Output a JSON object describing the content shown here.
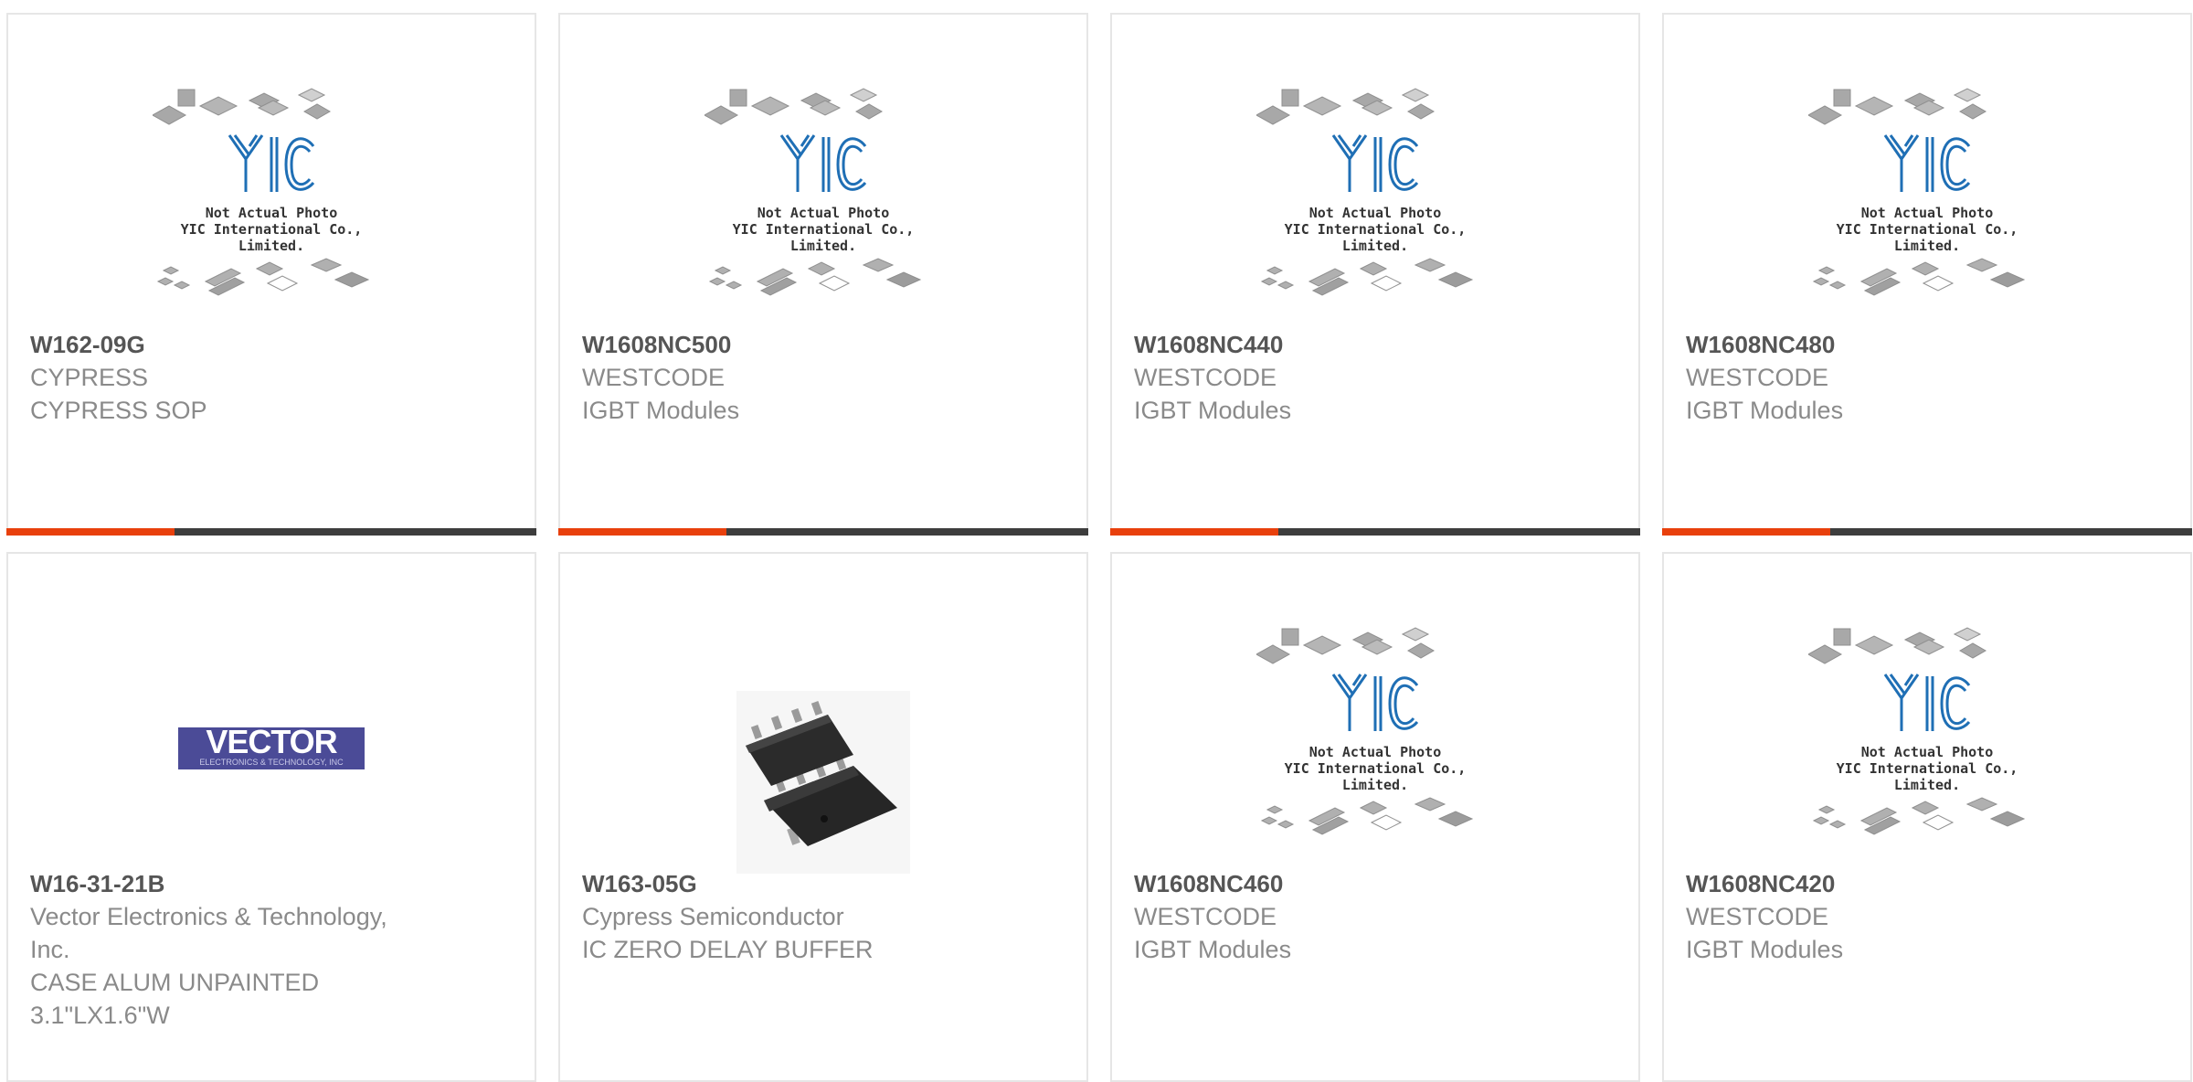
{
  "placeholder_caption": {
    "line1": "Not Actual Photo",
    "line2": "YIC International Co., Limited.",
    "logo_text": "YIC"
  },
  "colors": {
    "accent": "#e8400c",
    "bar": "#3d3d3d",
    "border": "#e6e6e6"
  },
  "products": [
    {
      "part_number": "W162-09G",
      "manufacturer": "CYPRESS",
      "description": "CYPRESS SOP",
      "image": "yic-placeholder"
    },
    {
      "part_number": "W1608NC500",
      "manufacturer": "WESTCODE",
      "description": "IGBT Modules",
      "image": "yic-placeholder"
    },
    {
      "part_number": "W1608NC440",
      "manufacturer": "WESTCODE",
      "description": "IGBT Modules",
      "image": "yic-placeholder"
    },
    {
      "part_number": "W1608NC480",
      "manufacturer": "WESTCODE",
      "description": "IGBT Modules",
      "image": "yic-placeholder"
    },
    {
      "part_number": "W16-31-21B",
      "manufacturer": "Vector Electronics & Technology, Inc.",
      "description": "CASE ALUM UNPAINTED 3.1\"LX1.6\"W",
      "image": "vector-logo",
      "logo_big": "VECTOR",
      "logo_small": "ELECTRONICS & TECHNOLOGY, INC"
    },
    {
      "part_number": "W163-05G",
      "manufacturer": "Cypress Semiconductor",
      "description": "IC ZERO DELAY BUFFER",
      "image": "sop8-chip-photo"
    },
    {
      "part_number": "W1608NC460",
      "manufacturer": "WESTCODE",
      "description": "IGBT Modules",
      "image": "yic-placeholder"
    },
    {
      "part_number": "W1608NC420",
      "manufacturer": "WESTCODE",
      "description": "IGBT Modules",
      "image": "yic-placeholder"
    }
  ]
}
